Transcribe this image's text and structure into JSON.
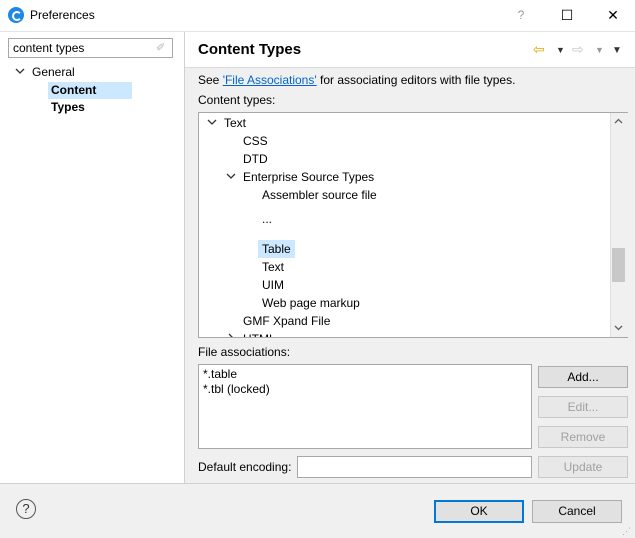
{
  "window": {
    "title": "Preferences",
    "help_glyph": "?",
    "maximize_glyph": "☐",
    "close_glyph": "✕"
  },
  "sidebar": {
    "filter_value": "content types",
    "tree": {
      "general": {
        "label": "General",
        "arrow": "❯"
      },
      "content_types": {
        "label": "Content Types"
      }
    }
  },
  "header": {
    "title": "Content Types",
    "back_icon": "⇦",
    "forward_icon": "⇨",
    "menu_glyph": "▼"
  },
  "main": {
    "description_prefix": "See ",
    "description_link": "'File Associations'",
    "description_suffix": " for associating editors with file types.",
    "content_types_label": "Content types:",
    "content_types_tree": [
      {
        "label": "Text",
        "expander": "v"
      },
      {
        "label": "CSS",
        "expander": ""
      },
      {
        "label": "DTD",
        "expander": ""
      },
      {
        "label": "Enterprise Source Types",
        "expander": "v"
      },
      {
        "label": "Assembler source file",
        "expander": ""
      },
      {
        "label": "...",
        "expander": ""
      },
      {
        "label": "Table",
        "expander": ""
      },
      {
        "label": "Text",
        "expander": ""
      },
      {
        "label": "UIM",
        "expander": ""
      },
      {
        "label": "Web page markup",
        "expander": ""
      },
      {
        "label": "GMF Xpand File",
        "expander": ""
      },
      {
        "label": "HTML",
        "expander": ">"
      }
    ],
    "file_associations_label": "File associations:",
    "file_associations": [
      "*.table",
      "*.tbl (locked)"
    ],
    "buttons": {
      "add": "Add...",
      "edit": "Edit...",
      "remove": "Remove",
      "update": "Update"
    },
    "default_encoding_label": "Default encoding:",
    "default_encoding_value": ""
  },
  "footer": {
    "ok": "OK",
    "cancel": "Cancel",
    "help_glyph": "?"
  },
  "colors": {
    "selection": "#cce8ff",
    "link": "#0066cc",
    "accent": "#0078d7"
  }
}
